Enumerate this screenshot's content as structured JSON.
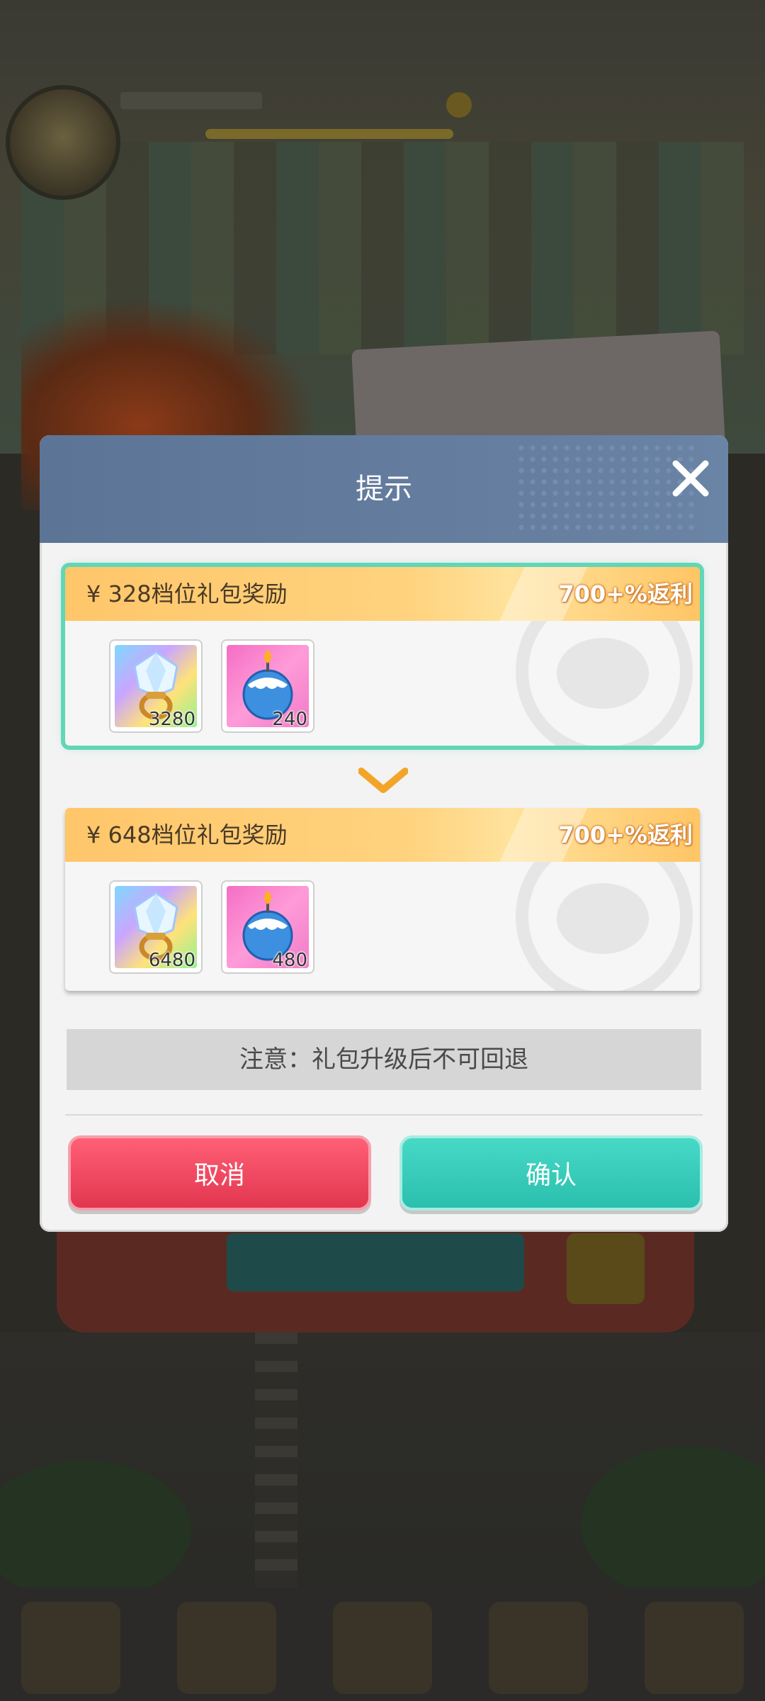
{
  "modal": {
    "title": "提示",
    "tiers": [
      {
        "title": "¥ 328档位礼包奖励",
        "rebate": "700+%返利",
        "selected": true,
        "items": [
          {
            "icon": "rainbow-gem-pacifier-icon",
            "count": "3280"
          },
          {
            "icon": "blue-candle-icon",
            "count": "240"
          }
        ]
      },
      {
        "title": "¥ 648档位礼包奖励",
        "rebate": "700+%返利",
        "selected": false,
        "items": [
          {
            "icon": "rainbow-gem-pacifier-icon",
            "count": "6480"
          },
          {
            "icon": "blue-candle-icon",
            "count": "480"
          }
        ]
      }
    ],
    "notice": "注意：礼包升级后不可回退",
    "cancel_label": "取消",
    "confirm_label": "确认"
  },
  "colors": {
    "header": "#617a9c",
    "selected_outline": "#62d6b6",
    "cancel": "#e8445b",
    "confirm": "#35c9b7",
    "tier_head": "#ffc66a"
  }
}
